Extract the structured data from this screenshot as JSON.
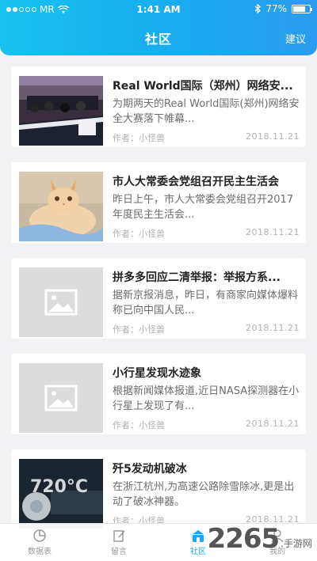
{
  "status_bar": {
    "carrier": "MR",
    "time": "1:41 AM",
    "battery": "77%",
    "battery_level": 0.77
  },
  "header": {
    "title": "社区",
    "right_action": "建议"
  },
  "articles": [
    {
      "title": "Real World国际（郑州）网络安...",
      "summary": "为期两天的Real World国际(郑州)网络安全大赛落下帷幕...",
      "author": "作者：小怪兽",
      "date": "2018.11.21",
      "thumb": "photo-conference"
    },
    {
      "title": "市人大常委会党组召开民主生活会",
      "summary": "昨日上午，市人大常委会党组召开2017年度民主生活会...",
      "author": "作者：小怪兽",
      "date": "2018.11.21",
      "thumb": "photo-cat"
    },
    {
      "title": "拼多多回应二清举报：举报方系...",
      "summary": "据新京报消息，昨日，有商家向媒体爆料称已向中国人民...",
      "author": "作者：小怪兽",
      "date": "2018.11.21",
      "thumb": "image-placeholder-icon"
    },
    {
      "title": "小行星发现水迹象",
      "summary": "根据新闻媒体报道,近日NASA探测器在小行星上发现了有...",
      "author": "作者：小怪兽",
      "date": "2018.11.21",
      "thumb": "image-placeholder-icon"
    },
    {
      "title": "歼5发动机破冰",
      "summary": "在浙江杭州,为高速公路除雪除冰,更是出动了破冰神器。",
      "author": "作者：小怪兽",
      "date": "2018.11.21",
      "thumb": "photo-jet-engine",
      "thumb_overlay": "720°C"
    }
  ],
  "tabbar": {
    "items": [
      {
        "label": "数据表",
        "icon": "pie-chart-icon"
      },
      {
        "label": "留言",
        "icon": "edit-icon"
      },
      {
        "label": "社区",
        "icon": "community-icon",
        "active": true
      },
      {
        "label": "我的",
        "icon": "user-icon"
      }
    ]
  },
  "watermark": {
    "number": "2265",
    "text": ".手游网"
  },
  "colors": {
    "accent": "#1aa9ee",
    "header_gradient_start": "#17c2f0",
    "text_primary": "#222222",
    "text_secondary": "#6c6c6c",
    "text_muted": "#b2b2b2"
  }
}
